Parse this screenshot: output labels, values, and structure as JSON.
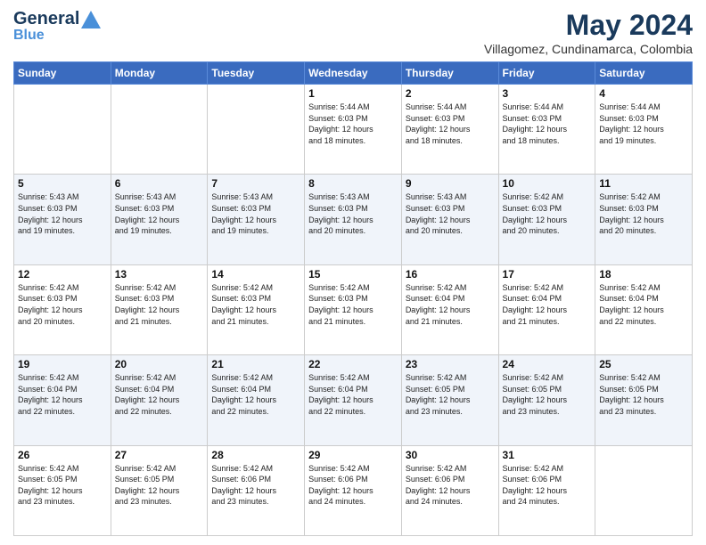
{
  "logo": {
    "name": "General",
    "accent": "Blue",
    "tagline": "Blue"
  },
  "header": {
    "month_year": "May 2024",
    "location": "Villagomez, Cundinamarca, Colombia"
  },
  "days_of_week": [
    "Sunday",
    "Monday",
    "Tuesday",
    "Wednesday",
    "Thursday",
    "Friday",
    "Saturday"
  ],
  "weeks": [
    [
      {
        "day": "",
        "info": ""
      },
      {
        "day": "",
        "info": ""
      },
      {
        "day": "",
        "info": ""
      },
      {
        "day": "1",
        "info": "Sunrise: 5:44 AM\nSunset: 6:03 PM\nDaylight: 12 hours\nand 18 minutes."
      },
      {
        "day": "2",
        "info": "Sunrise: 5:44 AM\nSunset: 6:03 PM\nDaylight: 12 hours\nand 18 minutes."
      },
      {
        "day": "3",
        "info": "Sunrise: 5:44 AM\nSunset: 6:03 PM\nDaylight: 12 hours\nand 18 minutes."
      },
      {
        "day": "4",
        "info": "Sunrise: 5:44 AM\nSunset: 6:03 PM\nDaylight: 12 hours\nand 19 minutes."
      }
    ],
    [
      {
        "day": "5",
        "info": "Sunrise: 5:43 AM\nSunset: 6:03 PM\nDaylight: 12 hours\nand 19 minutes."
      },
      {
        "day": "6",
        "info": "Sunrise: 5:43 AM\nSunset: 6:03 PM\nDaylight: 12 hours\nand 19 minutes."
      },
      {
        "day": "7",
        "info": "Sunrise: 5:43 AM\nSunset: 6:03 PM\nDaylight: 12 hours\nand 19 minutes."
      },
      {
        "day": "8",
        "info": "Sunrise: 5:43 AM\nSunset: 6:03 PM\nDaylight: 12 hours\nand 20 minutes."
      },
      {
        "day": "9",
        "info": "Sunrise: 5:43 AM\nSunset: 6:03 PM\nDaylight: 12 hours\nand 20 minutes."
      },
      {
        "day": "10",
        "info": "Sunrise: 5:42 AM\nSunset: 6:03 PM\nDaylight: 12 hours\nand 20 minutes."
      },
      {
        "day": "11",
        "info": "Sunrise: 5:42 AM\nSunset: 6:03 PM\nDaylight: 12 hours\nand 20 minutes."
      }
    ],
    [
      {
        "day": "12",
        "info": "Sunrise: 5:42 AM\nSunset: 6:03 PM\nDaylight: 12 hours\nand 20 minutes."
      },
      {
        "day": "13",
        "info": "Sunrise: 5:42 AM\nSunset: 6:03 PM\nDaylight: 12 hours\nand 21 minutes."
      },
      {
        "day": "14",
        "info": "Sunrise: 5:42 AM\nSunset: 6:03 PM\nDaylight: 12 hours\nand 21 minutes."
      },
      {
        "day": "15",
        "info": "Sunrise: 5:42 AM\nSunset: 6:03 PM\nDaylight: 12 hours\nand 21 minutes."
      },
      {
        "day": "16",
        "info": "Sunrise: 5:42 AM\nSunset: 6:04 PM\nDaylight: 12 hours\nand 21 minutes."
      },
      {
        "day": "17",
        "info": "Sunrise: 5:42 AM\nSunset: 6:04 PM\nDaylight: 12 hours\nand 21 minutes."
      },
      {
        "day": "18",
        "info": "Sunrise: 5:42 AM\nSunset: 6:04 PM\nDaylight: 12 hours\nand 22 minutes."
      }
    ],
    [
      {
        "day": "19",
        "info": "Sunrise: 5:42 AM\nSunset: 6:04 PM\nDaylight: 12 hours\nand 22 minutes."
      },
      {
        "day": "20",
        "info": "Sunrise: 5:42 AM\nSunset: 6:04 PM\nDaylight: 12 hours\nand 22 minutes."
      },
      {
        "day": "21",
        "info": "Sunrise: 5:42 AM\nSunset: 6:04 PM\nDaylight: 12 hours\nand 22 minutes."
      },
      {
        "day": "22",
        "info": "Sunrise: 5:42 AM\nSunset: 6:04 PM\nDaylight: 12 hours\nand 22 minutes."
      },
      {
        "day": "23",
        "info": "Sunrise: 5:42 AM\nSunset: 6:05 PM\nDaylight: 12 hours\nand 23 minutes."
      },
      {
        "day": "24",
        "info": "Sunrise: 5:42 AM\nSunset: 6:05 PM\nDaylight: 12 hours\nand 23 minutes."
      },
      {
        "day": "25",
        "info": "Sunrise: 5:42 AM\nSunset: 6:05 PM\nDaylight: 12 hours\nand 23 minutes."
      }
    ],
    [
      {
        "day": "26",
        "info": "Sunrise: 5:42 AM\nSunset: 6:05 PM\nDaylight: 12 hours\nand 23 minutes."
      },
      {
        "day": "27",
        "info": "Sunrise: 5:42 AM\nSunset: 6:05 PM\nDaylight: 12 hours\nand 23 minutes."
      },
      {
        "day": "28",
        "info": "Sunrise: 5:42 AM\nSunset: 6:06 PM\nDaylight: 12 hours\nand 23 minutes."
      },
      {
        "day": "29",
        "info": "Sunrise: 5:42 AM\nSunset: 6:06 PM\nDaylight: 12 hours\nand 24 minutes."
      },
      {
        "day": "30",
        "info": "Sunrise: 5:42 AM\nSunset: 6:06 PM\nDaylight: 12 hours\nand 24 minutes."
      },
      {
        "day": "31",
        "info": "Sunrise: 5:42 AM\nSunset: 6:06 PM\nDaylight: 12 hours\nand 24 minutes."
      },
      {
        "day": "",
        "info": ""
      }
    ]
  ]
}
